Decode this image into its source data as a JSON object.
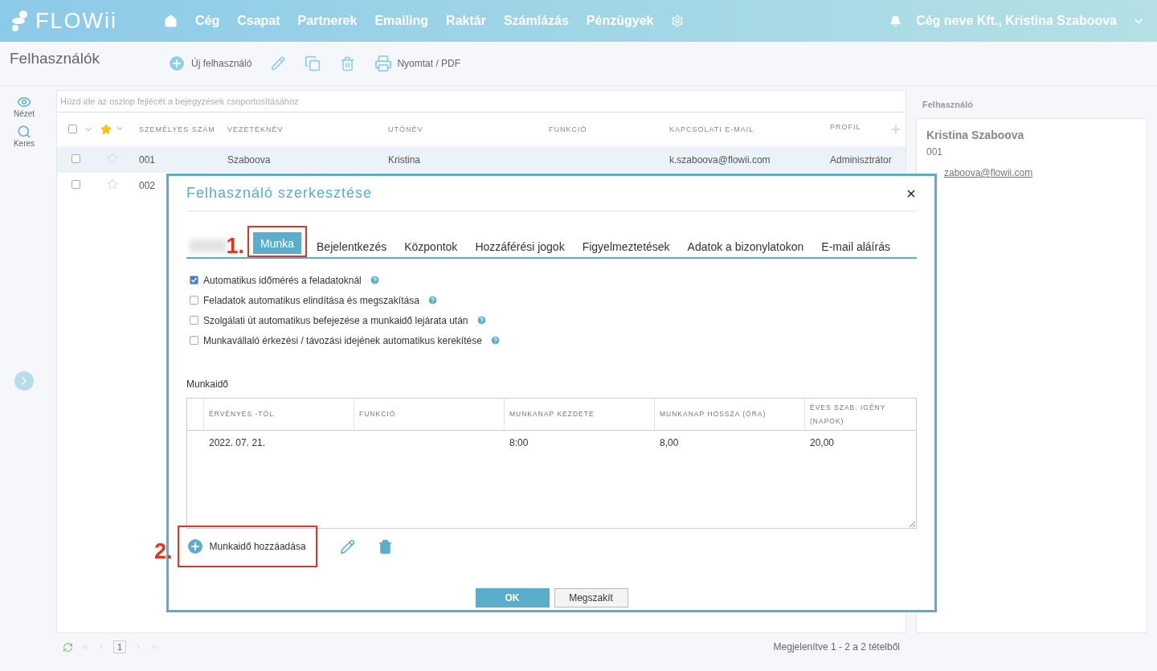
{
  "header": {
    "logo": "FLOWii",
    "nav": [
      {
        "kind": "home"
      },
      {
        "kind": "link",
        "label": "Cég"
      },
      {
        "kind": "link",
        "label": "Csapat"
      },
      {
        "kind": "link",
        "label": "Partnerek"
      },
      {
        "kind": "link",
        "label": "Emailing"
      },
      {
        "kind": "link",
        "label": "Raktár"
      },
      {
        "kind": "link",
        "label": "Számlázás"
      },
      {
        "kind": "link",
        "label": "Pénzügyek"
      },
      {
        "kind": "settings"
      }
    ],
    "account": "Cég neve Kft., Kristina Szaboova"
  },
  "page": {
    "title": "Felhasználók",
    "toolbar": [
      {
        "kind": "add",
        "label": "Új felhasználó"
      },
      {
        "kind": "edit"
      },
      {
        "kind": "copy"
      },
      {
        "kind": "delete"
      },
      {
        "kind": "print",
        "label": "Nyomtat / PDF"
      }
    ]
  },
  "sidebar": {
    "items": [
      {
        "kind": "view",
        "label": "Nézet"
      },
      {
        "kind": "search",
        "label": "Keres"
      }
    ]
  },
  "grid": {
    "all_checked": false,
    "group_hint": "Húzd ide az oszlop fejlécét a bejegyzések csoportosításához",
    "columns": [
      "SZEMÉLYES SZÁM",
      "VEZETÉKNÉV",
      "UTÓNÉV",
      "FUNKCIÓ",
      "KAPCSOLATI E-MAIL",
      "PROFIL"
    ],
    "rows": [
      {
        "selected": true,
        "checked": false,
        "starred": false,
        "cells": [
          "001",
          "Szaboova",
          "Kristina",
          "",
          "k.szaboova@flowii.com",
          "Adminisztrátor"
        ]
      },
      {
        "selected": false,
        "checked": false,
        "starred": false,
        "cells": [
          "002"
        ]
      }
    ]
  },
  "footer": {
    "page": "1",
    "summary": "Megjelenítve 1 - 2 a 2 tételből"
  },
  "detail": {
    "title": "Felhasználó",
    "name": "Kristina Szaboova",
    "number": "001",
    "email": "zaboova@flowii.com"
  },
  "dialog": {
    "title": "Felhasználó szerkesztése",
    "tabs": [
      {
        "kind": "blurred",
        "selected": false
      },
      {
        "kind": "tab",
        "label": "Munka",
        "selected": true,
        "annotation": "1."
      },
      {
        "kind": "tab",
        "label": "Bejelentkezés",
        "selected": false
      },
      {
        "kind": "tab",
        "label": "Központok",
        "selected": false
      },
      {
        "kind": "tab",
        "label": "Hozzáférési jogok",
        "selected": false
      },
      {
        "kind": "tab",
        "label": "Figyelmeztetések",
        "selected": false
      },
      {
        "kind": "tab",
        "label": "Adatok a bizonylatokon",
        "selected": false
      },
      {
        "kind": "tab",
        "label": "E-mail aláírás",
        "selected": false
      }
    ],
    "options": [
      {
        "label": "Automatikus időmérés a feladatoknál",
        "checked": true
      },
      {
        "label": "Feladatok automatikus elindítása és megszakítása",
        "checked": false
      },
      {
        "label": "Szolgálati út automatikus befejezése a munkaidő lejárata után",
        "checked": false
      },
      {
        "label": "Munkavállaló érkezési / távozási idejének automatikus kerekítése",
        "checked": false
      }
    ],
    "section": "Munkaidő",
    "table": {
      "columns": [
        "ÉRVÉNYES -TÓL",
        "FUNKCIÓ",
        "MUNKANAP KEZDETE",
        "MUNKANAP HOSSZA (ÓRA)",
        "ÉVES SZAB. IGÉNY (NAPOK)"
      ],
      "rows": [
        [
          "2022. 07. 21.",
          "",
          "8:00",
          "8,00",
          "20,00"
        ]
      ]
    },
    "add": {
      "label": "Munkaidő hozzáadása",
      "annotation": "2."
    },
    "buttons": [
      {
        "kind": "primary",
        "label": "OK"
      },
      {
        "kind": "secondary",
        "label": "Megszakít"
      }
    ]
  }
}
